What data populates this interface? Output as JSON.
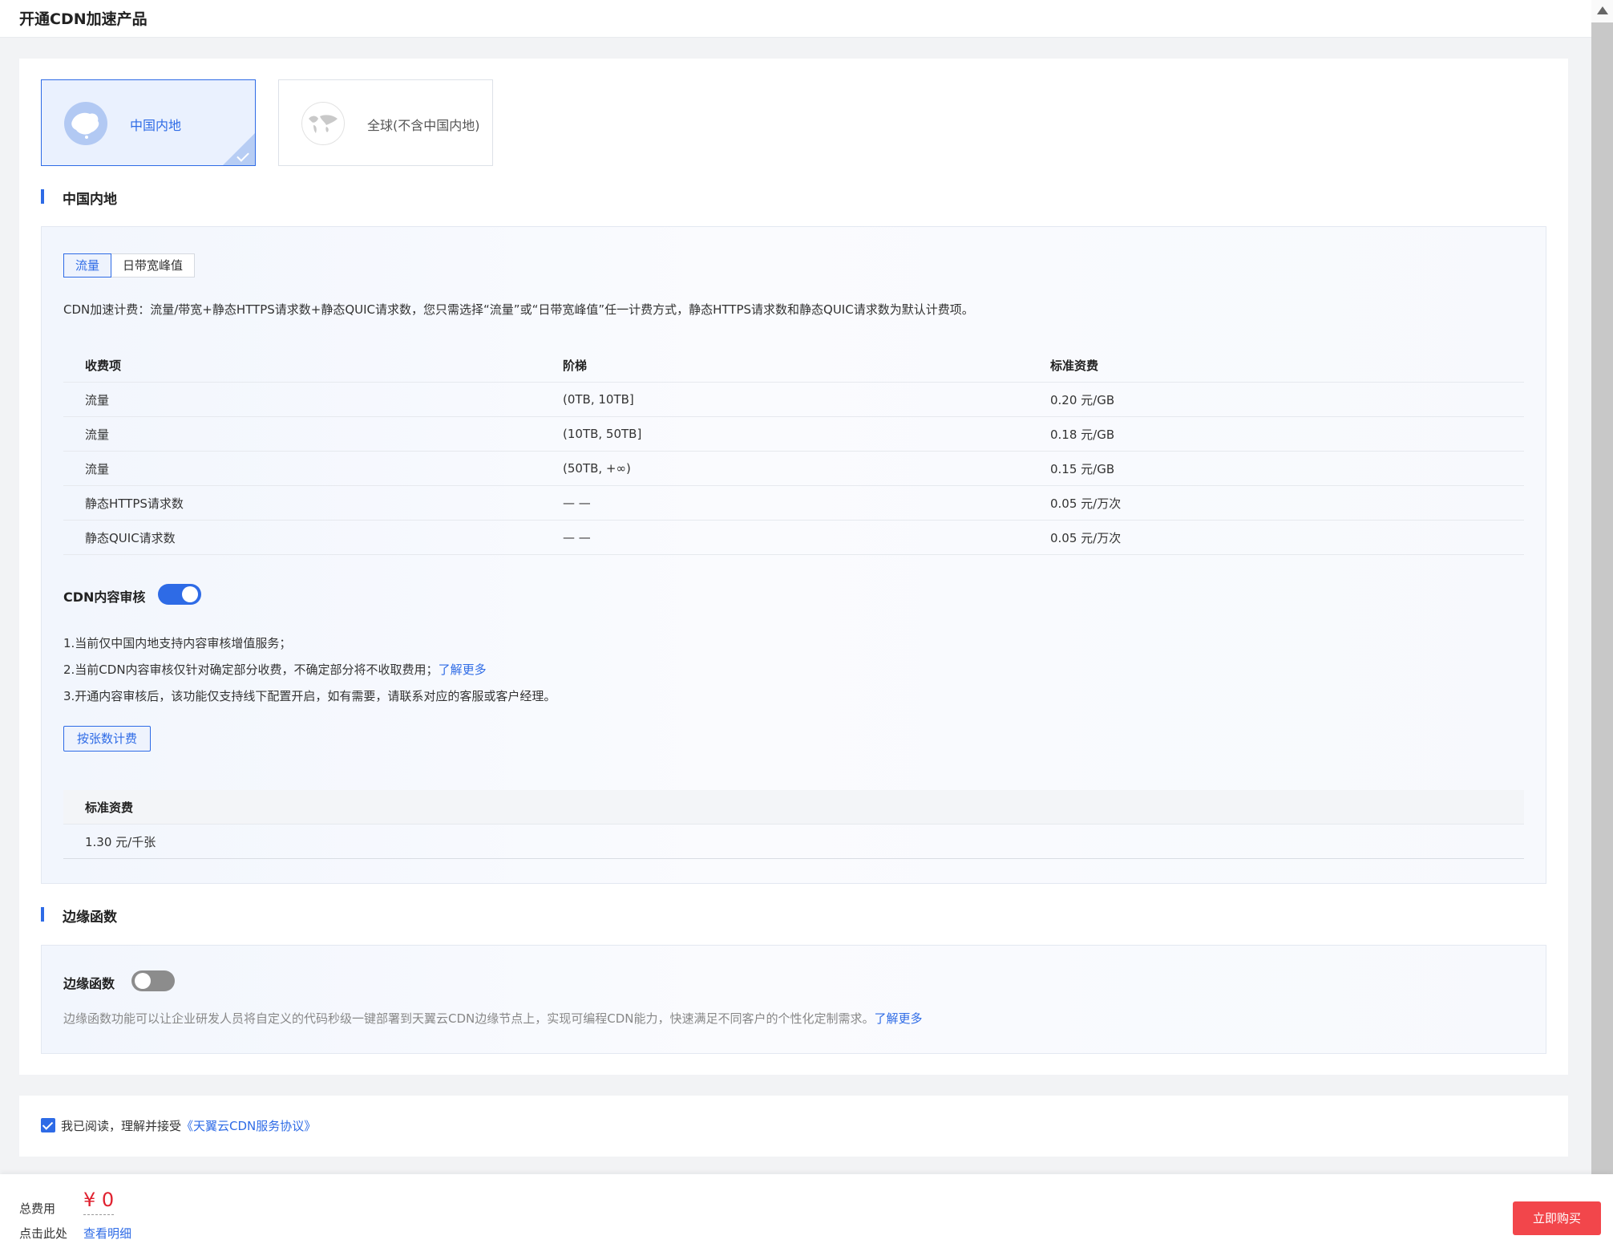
{
  "header": {
    "title": "开通CDN加速产品"
  },
  "regions": [
    {
      "label": "中国内地",
      "selected": true
    },
    {
      "label": "全球(不含中国内地)",
      "selected": false
    }
  ],
  "section_mainland": {
    "title": "中国内地",
    "billing_tabs": [
      "流量",
      "日带宽峰值"
    ],
    "active_tab": "流量",
    "description": "CDN加速计费：流量/带宽+静态HTTPS请求数+静态QUIC请求数，您只需选择“流量”或“日带宽峰值”任一计费方式，静态HTTPS请求数和静态QUIC请求数为默认计费项。",
    "price_table": {
      "headers": [
        "收费项",
        "阶梯",
        "标准资费"
      ],
      "rows": [
        [
          "流量",
          "(0TB, 10TB]",
          "0.20 元/GB"
        ],
        [
          "流量",
          "(10TB, 50TB]",
          "0.18 元/GB"
        ],
        [
          "流量",
          "(50TB, +∞)",
          "0.15 元/GB"
        ],
        [
          "静态HTTPS请求数",
          "— —",
          "0.05 元/万次"
        ],
        [
          "静态QUIC请求数",
          "— —",
          "0.05 元/万次"
        ]
      ]
    },
    "content_audit": {
      "label": "CDN内容审核",
      "enabled": true,
      "notes": [
        "1.当前仅中国内地支持内容审核增值服务；",
        "2.当前CDN内容审核仅针对确定部分收费，不确定部分将不收取费用；",
        "3.开通内容审核后，该功能仅支持线下配置开启，如有需要，请联系对应的客服或客户经理。"
      ],
      "learn_more": "了解更多",
      "billing_button": "按张数计费",
      "fee_header": "标准资费",
      "fee_value": "1.30 元/千张"
    }
  },
  "section_edge": {
    "title": "边缘函数",
    "toggle_label": "边缘函数",
    "enabled": false,
    "description": "边缘函数功能可以让企业研发人员将自定义的代码秒级一键部署到天翼云CDN边缘节点上，实现可编程CDN能力，快速满足不同客户的个性化定制需求。",
    "learn_more": "了解更多"
  },
  "agreement": {
    "checked": true,
    "text": "我已阅读，理解并接受",
    "link": "《天翼云CDN服务协议》"
  },
  "footer": {
    "total_label": "总费用",
    "total_value": "¥ 0",
    "detail_label": "点击此处",
    "detail_link": "查看明细",
    "buy_button": "立即购买"
  },
  "colors": {
    "accent": "#2e6be6",
    "price": "#e0212f",
    "buy": "#f2464b"
  }
}
